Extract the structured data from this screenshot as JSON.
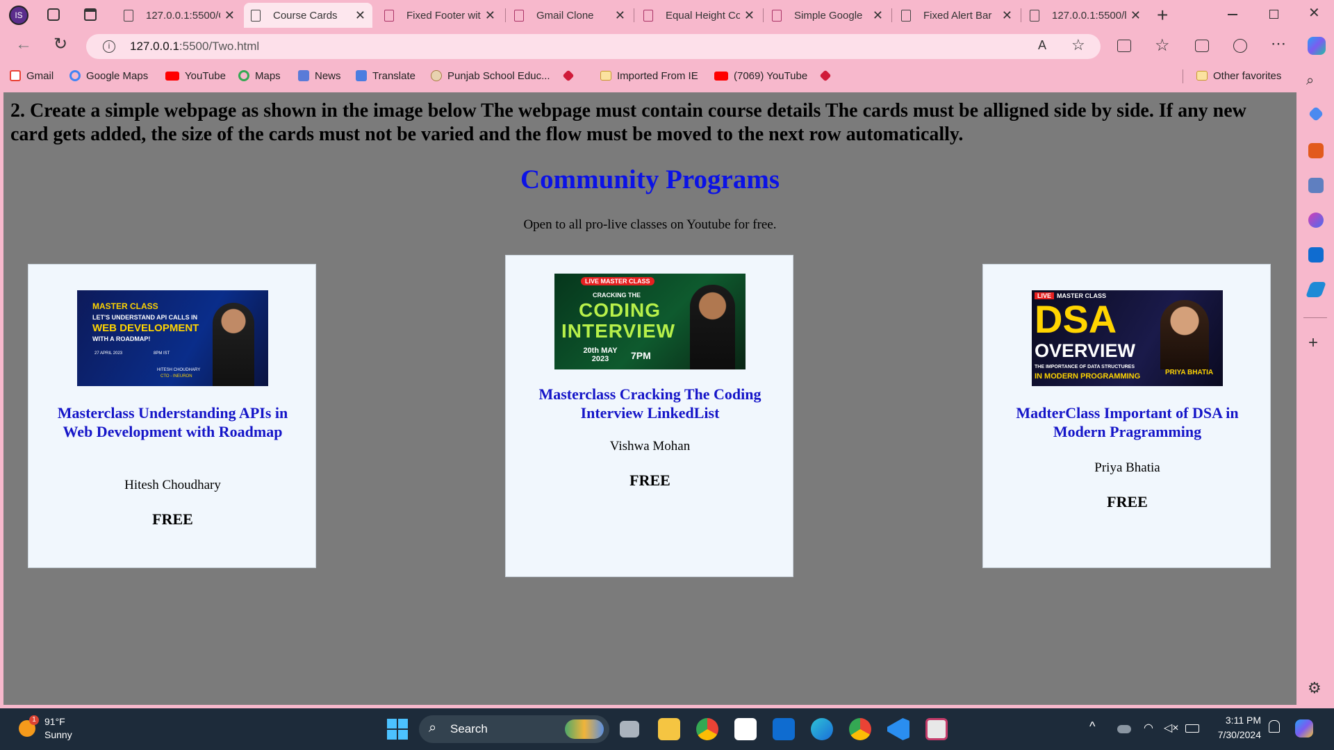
{
  "tabs": [
    {
      "label": "127.0.0.1:5500/C",
      "active": false
    },
    {
      "label": "Course Cards",
      "active": true
    },
    {
      "label": "Fixed Footer wit",
      "active": false
    },
    {
      "label": "Gmail Clone",
      "active": false
    },
    {
      "label": "Equal Height Co",
      "active": false
    },
    {
      "label": "Simple Google",
      "active": false
    },
    {
      "label": "Fixed Alert Bar",
      "active": false
    },
    {
      "label": "127.0.0.1:5500/l",
      "active": false
    }
  ],
  "profile": "IS",
  "address": {
    "url_host": "127.0.0.1",
    "url_rest": ":5500/Two.html"
  },
  "bookmarks": [
    {
      "label": "Gmail",
      "color": "#ea4335"
    },
    {
      "label": "Google Maps",
      "color": "#4285f4"
    },
    {
      "label": "YouTube",
      "color": "#ff0000"
    },
    {
      "label": "Maps",
      "color": "#34a853"
    },
    {
      "label": "News",
      "color": "#5a7bd8"
    },
    {
      "label": "Translate",
      "color": "#4a7de0"
    },
    {
      "label": "Punjab School Educ...",
      "color": "#c79a5a"
    },
    {
      "label": "",
      "color": "#d01b3a"
    },
    {
      "label": "Imported From IE",
      "color": "#f2c94c"
    },
    {
      "label": "(7069) YouTube",
      "color": "#ff0000"
    },
    {
      "label": "",
      "color": "#d01b3a"
    }
  ],
  "other_favorites": "Other favorites",
  "page": {
    "question": "2. Create a simple webpage as shown in the image below The webpage must contain course details The cards must be alligned side by side. If any new card gets added, the size of the cards must not be varied and the flow must be moved to the next row automatically.",
    "title": "Community Programs",
    "subtitle": "Open to all pro-live classes on Youtube for free.",
    "cards": [
      {
        "title": "Masterclass Understanding APIs in Web Development with Roadmap",
        "instructor": "Hitesh Choudhary",
        "price": "FREE",
        "thumb": {
          "line1": "MASTER CLASS",
          "line2": "LET'S UNDERSTAND API CALLS IN",
          "line3": "WEB DEVELOPMENT",
          "line4": "WITH A ROADMAP!",
          "name": "HITESH CHOUDHARY",
          "role": "CTO - INEURON",
          "date": "27 APRIL 2023",
          "time": "8PM IST"
        }
      },
      {
        "title": "Masterclass Cracking The Coding Interview LinkedList",
        "instructor": "Vishwa Mohan",
        "price": "FREE",
        "thumb": {
          "badge": "LIVE MASTER CLASS",
          "line1": "CRACKING THE",
          "line2": "CODING",
          "line3": "INTERVIEW",
          "date": "20th MAY 2023",
          "time": "7PM"
        }
      },
      {
        "title": "MadterClass Important of DSA in Modern Pragramming",
        "instructor": "Priya Bhatia",
        "price": "FREE",
        "thumb": {
          "badge": "LIVE",
          "badge2": "MASTER CLASS",
          "line1": "DSA",
          "line2": "OVERVIEW",
          "line3": "THE IMPORTANCE OF DATA STRUCTURES",
          "line4": "IN MODERN PROGRAMMING",
          "name": "PRIYA BHATIA"
        }
      }
    ]
  },
  "taskbar": {
    "weather_temp": "91°F",
    "weather_desc": "Sunny",
    "weather_badge": "1",
    "search": "Search",
    "time": "3:11 PM",
    "date": "7/30/2024"
  }
}
